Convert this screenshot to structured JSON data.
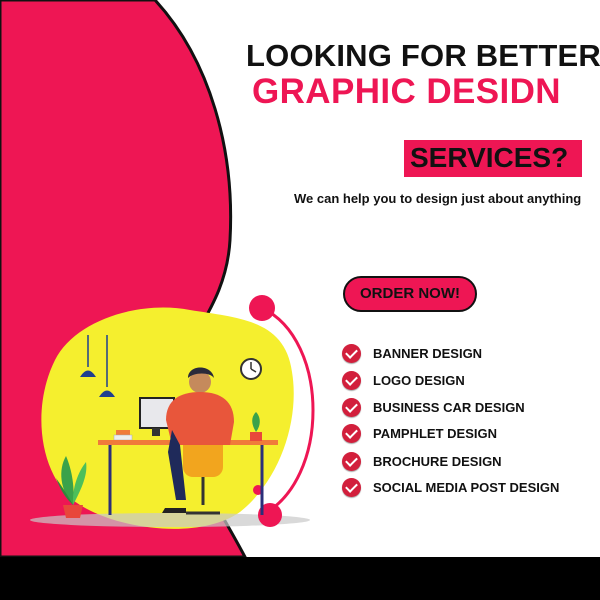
{
  "headline": {
    "line1": "LOOKING FOR BETTER",
    "line2": "GRAPHIC DESIDN",
    "line3": "SERVICES?"
  },
  "tagline": "We can help you to design just about anything",
  "cta": {
    "label": "ORDER NOW!"
  },
  "services": [
    {
      "label": "BANNER DESIGN",
      "icon": "check-circle-icon"
    },
    {
      "label": "LOGO DESIGN",
      "icon": "check-circle-icon"
    },
    {
      "label": "BUSINESS CAR DESIGN",
      "icon": "check-circle-icon"
    },
    {
      "label": "PAMPHLET DESIGN",
      "icon": "check-circle-icon"
    },
    {
      "label": "BROCHURE DESIGN",
      "icon": "check-circle-icon"
    },
    {
      "label": "SOCIAL MEDIA POST DESIGN",
      "icon": "check-circle-icon"
    }
  ],
  "colors": {
    "accent": "#ee1654",
    "blob": "#f5ef2e",
    "text": "#111111",
    "footer": "#000000"
  },
  "illustration": {
    "icons": [
      "pendant-lamp-icon",
      "wall-clock-icon",
      "monitor-icon",
      "books-icon",
      "potted-plant-icon",
      "office-chair-icon",
      "designer-figure-icon"
    ]
  }
}
